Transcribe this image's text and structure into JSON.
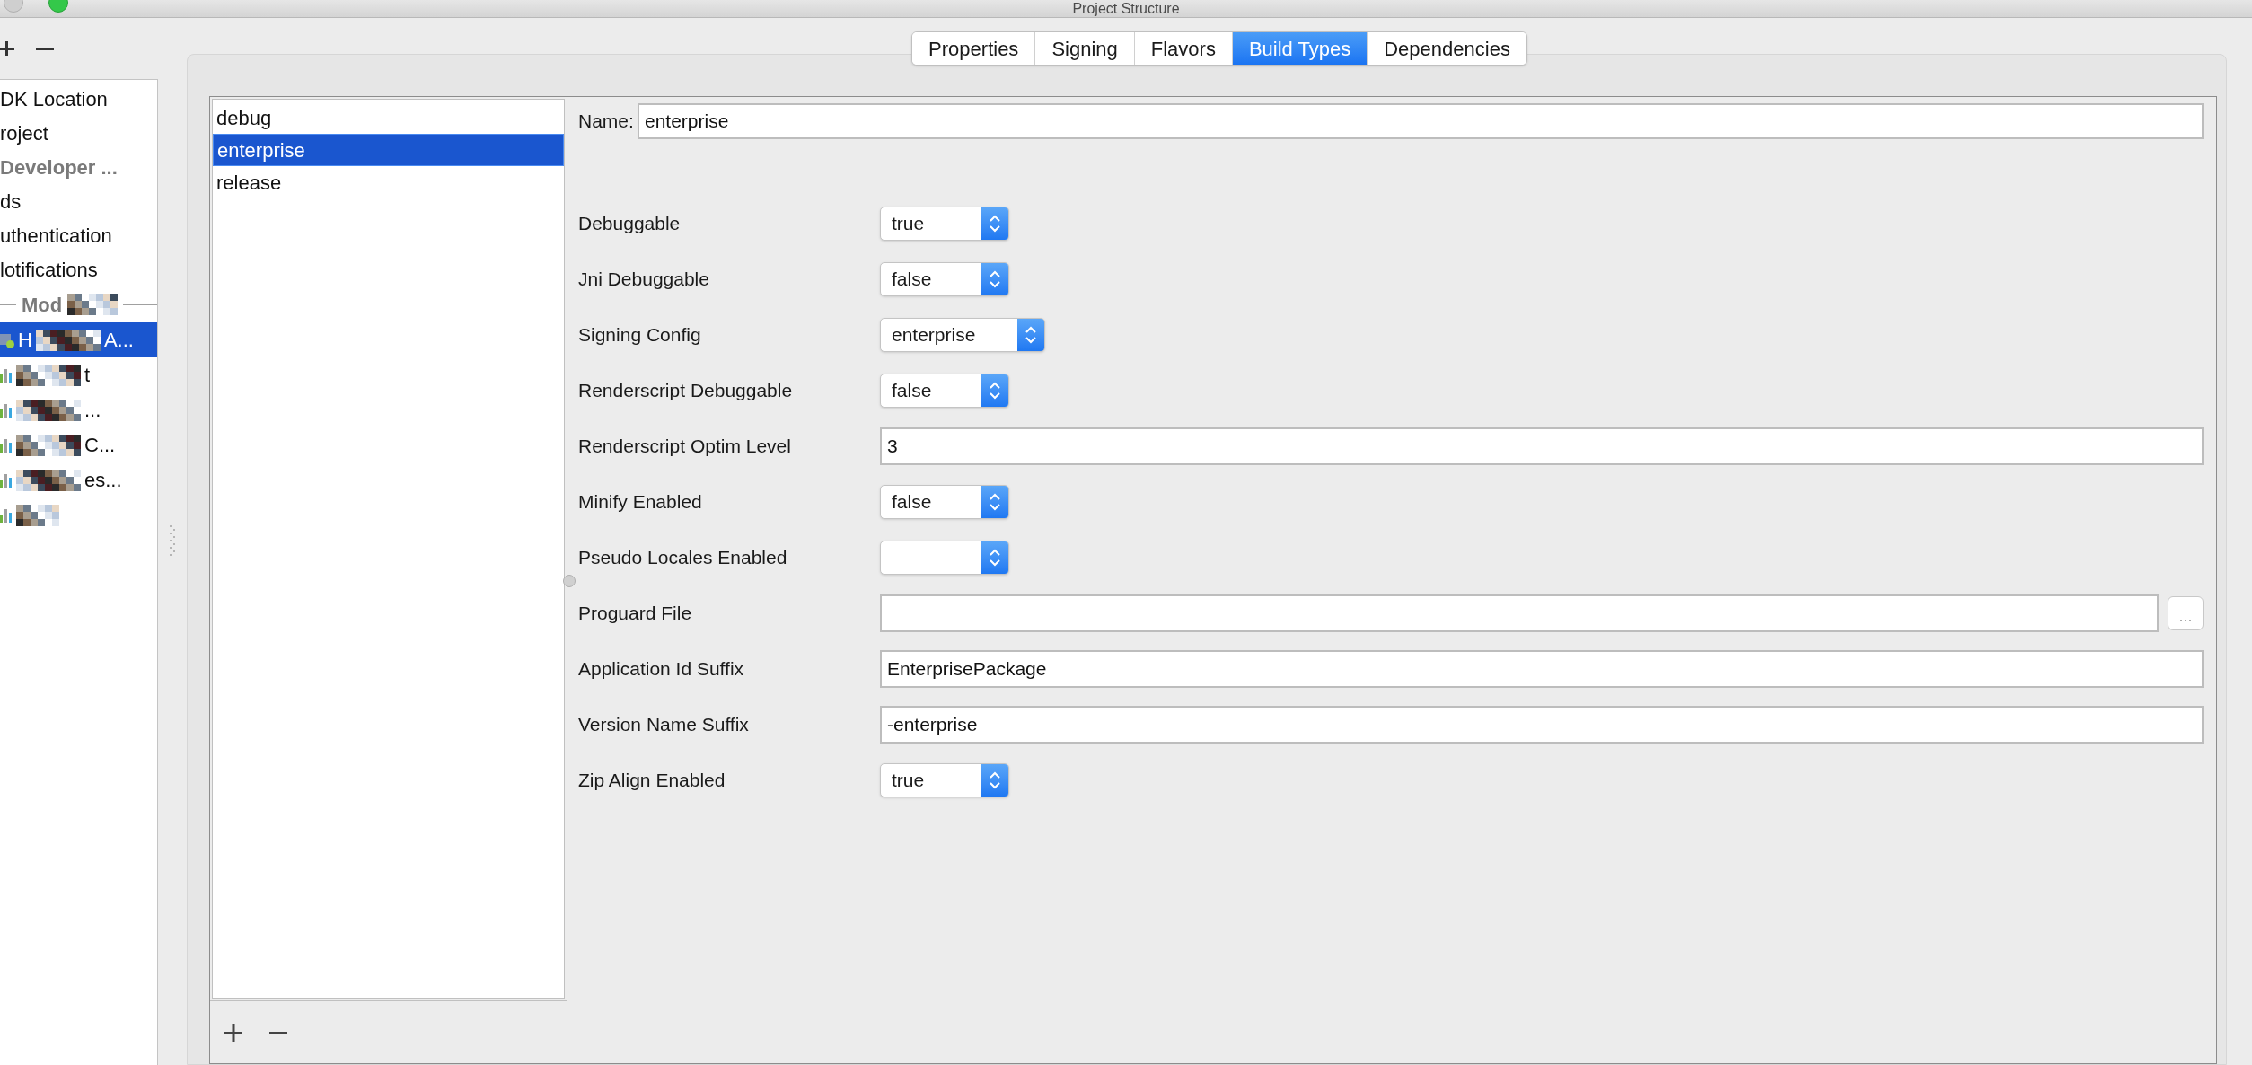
{
  "window": {
    "title": "Project Structure"
  },
  "sidebar": {
    "items": [
      {
        "label": "DK Location",
        "kind": "item"
      },
      {
        "label": "roject",
        "kind": "item"
      },
      {
        "label": "Developer ...",
        "kind": "section"
      },
      {
        "label": "ds",
        "kind": "item"
      },
      {
        "label": "uthentication",
        "kind": "item"
      },
      {
        "label": "lotifications",
        "kind": "item"
      }
    ],
    "modules_header": "Mod",
    "modules": [
      {
        "kind": "app",
        "prefix": "H",
        "suffix": "A...",
        "selected": true
      },
      {
        "kind": "library",
        "suffix": "t",
        "selected": false
      },
      {
        "kind": "library",
        "suffix": "...",
        "selected": false
      },
      {
        "kind": "library",
        "suffix": "C...",
        "selected": false
      },
      {
        "kind": "library",
        "suffix": "es...",
        "selected": false
      },
      {
        "kind": "library",
        "selected": false
      }
    ]
  },
  "tabs": [
    {
      "label": "Properties",
      "selected": false
    },
    {
      "label": "Signing",
      "selected": false
    },
    {
      "label": "Flavors",
      "selected": false
    },
    {
      "label": "Build Types",
      "selected": true
    },
    {
      "label": "Dependencies",
      "selected": false
    }
  ],
  "build_types": [
    {
      "label": "debug",
      "selected": false
    },
    {
      "label": "enterprise",
      "selected": true
    },
    {
      "label": "release",
      "selected": false
    }
  ],
  "form": {
    "name_label": "Name:",
    "name_value": "enterprise",
    "fields": [
      {
        "label": "Debuggable",
        "kind": "combo",
        "value": "true"
      },
      {
        "label": "Jni Debuggable",
        "kind": "combo",
        "value": "false"
      },
      {
        "label": "Signing Config",
        "kind": "combo",
        "value": "enterprise"
      },
      {
        "label": "Renderscript Debuggable",
        "kind": "combo",
        "value": "false"
      },
      {
        "label": "Renderscript Optim Level",
        "kind": "text",
        "value": "3"
      },
      {
        "label": "Minify Enabled",
        "kind": "combo",
        "value": "false"
      },
      {
        "label": "Pseudo Locales Enabled",
        "kind": "combo"
      },
      {
        "label": "Proguard File",
        "kind": "file",
        "button": "..."
      },
      {
        "label": "Application Id Suffix",
        "kind": "text",
        "value": "EnterprisePackage"
      },
      {
        "label": "Version Name Suffix",
        "kind": "text",
        "value": "-enterprise"
      },
      {
        "label": "Zip Align Enabled",
        "kind": "combo",
        "value": "true"
      }
    ]
  }
}
